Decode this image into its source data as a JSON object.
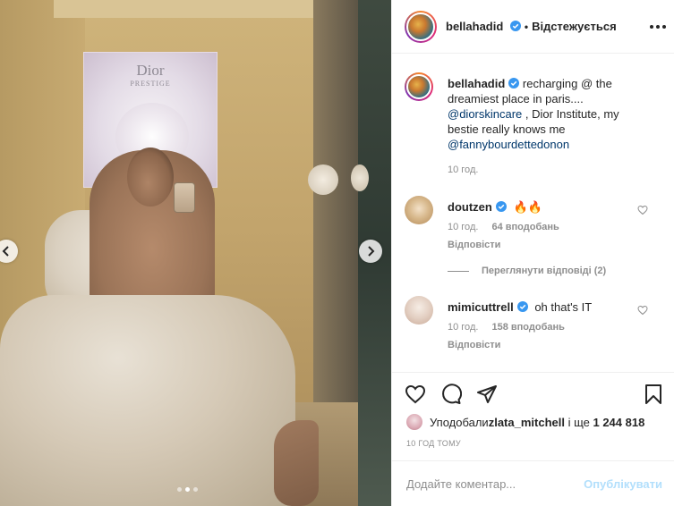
{
  "header": {
    "username": "bellahadid",
    "separator": "•",
    "follow_label": "Відстежується"
  },
  "caption": {
    "username": "bellahadid",
    "text_1": " recharging @ the dreamiest place in paris.... ",
    "mention_1": "@diorskincare",
    "text_2": " , Dior Institute, my bestie really knows me ",
    "mention_2": "@fannybourdettedonon",
    "time": "10 год."
  },
  "comments": [
    {
      "username": "doutzen",
      "text": "🔥🔥",
      "time": "10 год.",
      "likes": "64 вподобань",
      "reply_label": "Відповісти",
      "view_replies": "Переглянути відповіді (2)"
    },
    {
      "username": "mimicuttrell",
      "text": "oh that's IT",
      "time": "10 год.",
      "likes": "158 вподобань",
      "reply_label": "Відповісти"
    }
  ],
  "likes_line": {
    "prefix": "Уподобали ",
    "user": "zlata_mitchell",
    "middle": " і ще ",
    "count": "1 244 818"
  },
  "post_time": "10 ГОД ТОМУ",
  "comment_input": {
    "placeholder": "Додайте коментар...",
    "publish_label": "Опублікувати"
  },
  "media": {
    "lightbox_brand": "Dior",
    "lightbox_sub": "PRESTIGE"
  },
  "carousel": {
    "slide_count": 3,
    "active_index": 1
  },
  "colors": {
    "verified": "#3897f0",
    "link": "#00376b",
    "muted": "#8e8e8e",
    "publish_disabled": "#b2dffc"
  },
  "icons": [
    "heart-icon",
    "comment-icon",
    "share-icon",
    "bookmark-icon",
    "chevron-left-icon",
    "chevron-right-icon",
    "more-icon",
    "verified-icon"
  ]
}
